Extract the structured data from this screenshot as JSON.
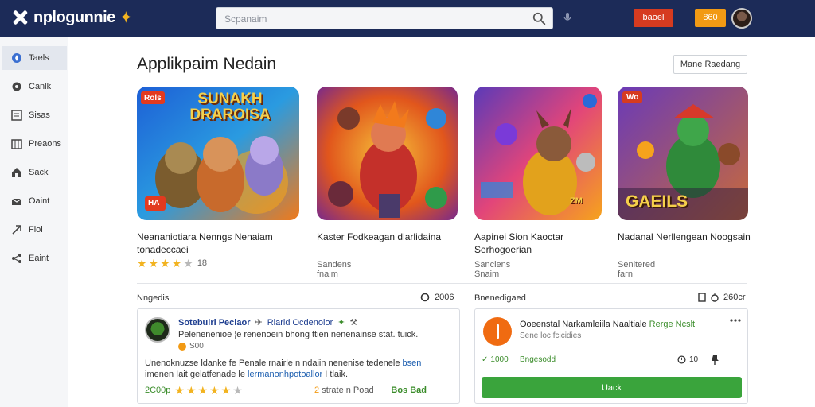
{
  "header": {
    "logo_text": "nplogunnie",
    "logo_mark": "✦",
    "search_placeholder": "Scpanaim",
    "red_button": "baoel",
    "orange_button": "860"
  },
  "sidebar": {
    "items": [
      {
        "label": "Taels",
        "icon": "compass-icon",
        "active": true
      },
      {
        "label": "Canlk",
        "icon": "chat-icon"
      },
      {
        "label": "Sisas",
        "icon": "list-icon"
      },
      {
        "label": "Preaons",
        "icon": "calendar-icon"
      },
      {
        "label": "Sack",
        "icon": "home-icon"
      },
      {
        "label": "Oaint",
        "icon": "inbox-icon"
      },
      {
        "label": "Fiol",
        "icon": "arrow-icon"
      },
      {
        "label": "Eaint",
        "icon": "share-icon"
      }
    ]
  },
  "main": {
    "title": "Applikpaim Nedain",
    "top_right_button": "Mane Raedang",
    "cards": [
      {
        "thumb_text": "SUNAKH DRAROISA",
        "badge": "Rols",
        "corner": "HA",
        "title": "Neananiotiara Nenngs Nenaiam tonadeccaei",
        "rating_count": "18",
        "stars": 4
      },
      {
        "thumb_text": "",
        "title": "Kaster Fodkeagan dlarlidaina",
        "sub": "Sandens fnaim"
      },
      {
        "thumb_text": "ZM",
        "title": "Aapinei Sion Kaoctar Serhogoerian",
        "sub": "Sanclens Snaim"
      },
      {
        "thumb_text": "GAEILS",
        "badge": "Wo",
        "title": "Nadanal Nerllengean Noogsain",
        "sub": "Senitered farn"
      }
    ],
    "left_section": {
      "label": "Nngedis",
      "tool": "2006"
    },
    "right_section": {
      "label": "Bnenedigaed",
      "tool": "260cr"
    },
    "review": {
      "name": "Sotebuiri Peclaor",
      "badge": "Rlarid Ocdenolor",
      "line1": "Pelenenenioe ¦e renenoein bhong ttien nenenainse stat. tuick.",
      "meta": "S00",
      "body_a": "Unenoknuzse ldanke fe Penale rnairle n ndaiin nenenise tedenele ",
      "body_link1": "bsen",
      "body_b": "imenen Iait gelatfenade le ",
      "body_link2": "lermanonhpotoallor",
      "body_c": " I tlaik.",
      "foot_left": "2C00p",
      "foot_mid_a": "2",
      "foot_mid_b": "strate n Poad",
      "foot_action": "Bos Bad"
    },
    "app_panel": {
      "title": "Ooeenstal Narkamleiila Naaltiale",
      "tag": "Rerge Ncslt",
      "sub": "Sene loc fcicidies",
      "stat1": "1000",
      "stat2": "Bngesodd",
      "stat3": "10",
      "button": "Uack"
    }
  }
}
